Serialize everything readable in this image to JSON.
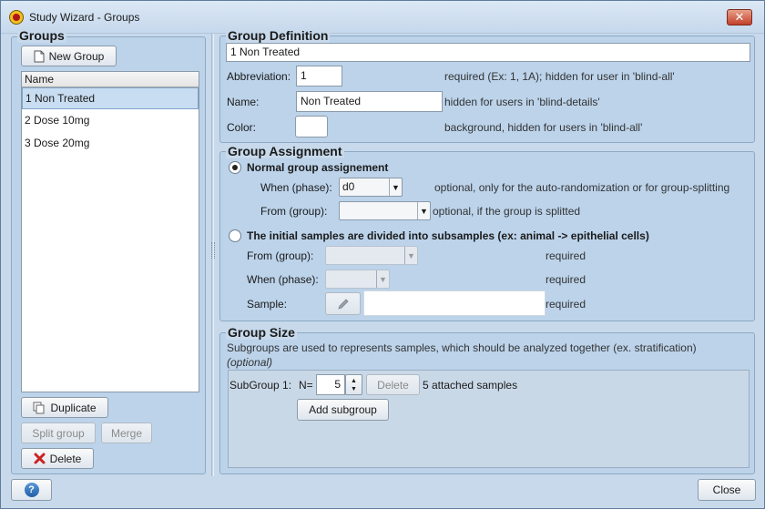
{
  "window": {
    "title": "Study Wizard - Groups",
    "close_glyph": "✕"
  },
  "groups_panel": {
    "title": "Groups",
    "new_group_label": "New Group",
    "list_header": "Name",
    "items": [
      {
        "label": "1 Non Treated",
        "selected": true
      },
      {
        "label": "2 Dose 10mg",
        "selected": false
      },
      {
        "label": "3 Dose 20mg",
        "selected": false
      }
    ],
    "duplicate_label": "Duplicate",
    "split_group_label": "Split group",
    "merge_label": "Merge",
    "delete_label": "Delete"
  },
  "definition": {
    "title": "Group Definition",
    "full_name": "1 Non Treated",
    "abbreviation_label": "Abbreviation:",
    "abbreviation_value": "1",
    "abbreviation_hint": "required (Ex: 1, 1A); hidden for user in  'blind-all'",
    "name_label": "Name:",
    "name_value": "Non Treated",
    "name_hint": "hidden for users in 'blind-details'",
    "color_label": "Color:",
    "color_value": "#ffffff",
    "color_hint": "background, hidden for users in 'blind-all'"
  },
  "assignment": {
    "title": "Group Assignment",
    "normal_label": "Normal group assignement",
    "when_phase_label": "When (phase):",
    "when_phase_value": "d0",
    "when_phase_hint": "optional, only for the auto-randomization or for group-splitting",
    "from_group_label": "From (group):",
    "from_group_value": "",
    "from_group_hint": "optional, if the group is splitted",
    "subsample_label": "The initial samples are divided into subsamples (ex: animal -> epithelial cells)",
    "sub_from_group_label": "From (group):",
    "sub_from_group_hint": "required",
    "sub_when_phase_label": "When (phase):",
    "sub_when_phase_hint": "required",
    "sample_label": "Sample:",
    "sample_hint": "required"
  },
  "size": {
    "title": "Group Size",
    "description": "Subgroups are used to represents samples, which should be analyzed together (ex. stratification)",
    "optional_note": "(optional)",
    "subgroup_label": "SubGroup 1:",
    "n_label": "N=",
    "n_value": "5",
    "delete_label": "Delete",
    "attached_text": "5 attached samples",
    "add_subgroup_label": "Add subgroup"
  },
  "footer": {
    "help_glyph": "?",
    "close_label": "Close"
  },
  "colors": {
    "window_bg": "#c7d9eb",
    "panel_bg": "#bcd3ea",
    "selection": "#c8ddf1",
    "delete_icon": "#cc2222"
  },
  "icons": {
    "title": "app-logo-icon",
    "new_group": "document-icon",
    "duplicate": "copy-icon",
    "delete": "red-x-icon",
    "sample": "pencil-icon",
    "help": "help-icon"
  }
}
